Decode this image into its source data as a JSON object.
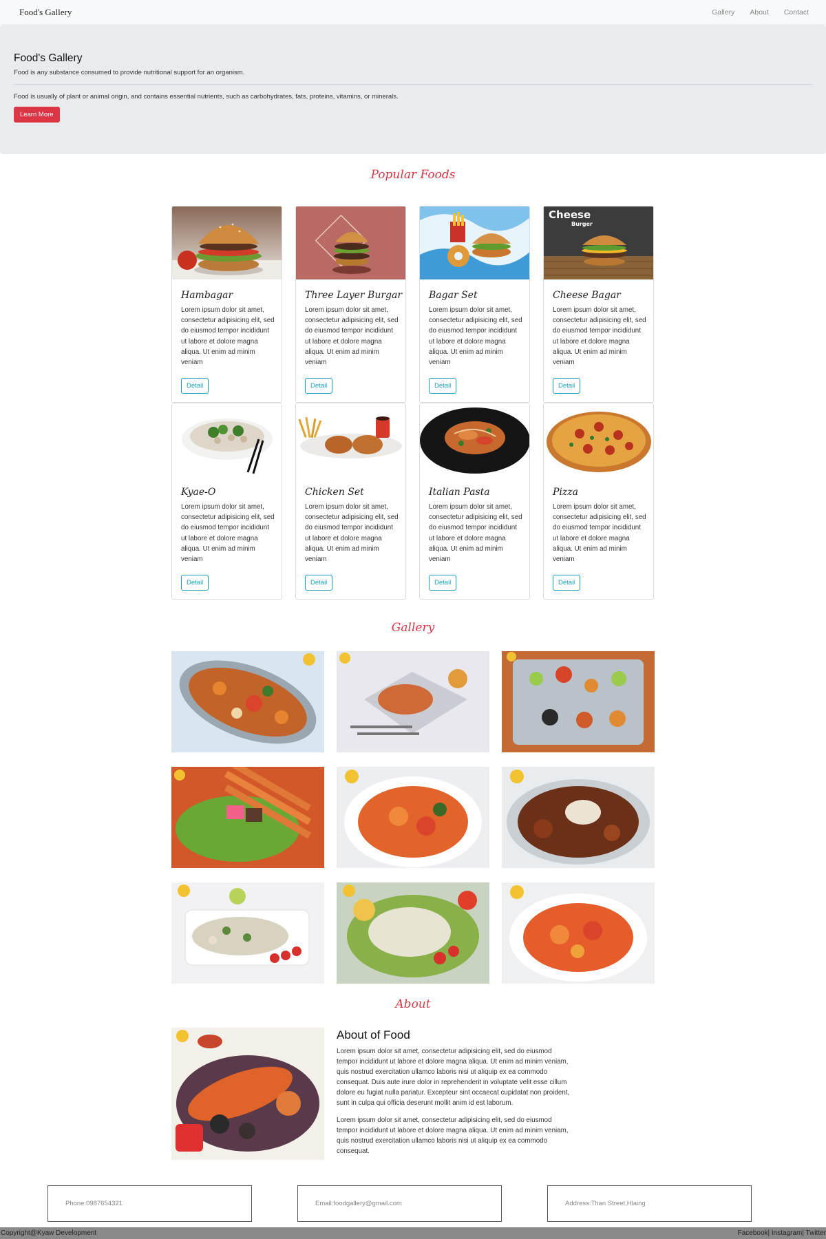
{
  "navbar": {
    "brand": "Food's Gallery",
    "links": [
      "Gallery",
      "About",
      "Contact"
    ]
  },
  "jumbotron": {
    "title": "Food's Gallery",
    "lead": "Food is any substance consumed to provide nutritional support for an organism.",
    "text": "Food is usually of plant or animal origin, and contains essential nutrients, such as carbohydrates, fats, proteins, vitamins, or minerals.",
    "button": "Learn More"
  },
  "popular": {
    "heading": "Popular Foods",
    "card_text": "Lorem ipsum dolor sit amet, consectetur adipisicing elit, sed do eiusmod tempor incididunt ut labore et dolore magna aliqua. Ut enim ad minim veniam",
    "detail_label": "Detail",
    "cards": [
      {
        "title": "Hambagar"
      },
      {
        "title": "Three Layer Burgar"
      },
      {
        "title": "Bagar Set"
      },
      {
        "title": "Cheese Bagar",
        "image_text": "Cheese",
        "image_subtext": "Burger"
      },
      {
        "title": "Kyae-O"
      },
      {
        "title": "Chicken Set"
      },
      {
        "title": "Italian Pasta"
      },
      {
        "title": "Pizza"
      }
    ]
  },
  "gallery": {
    "heading": "Gallery"
  },
  "about": {
    "heading": "About",
    "title": "About of Food",
    "p1": "Lorem ipsum dolor sit amet, consectetur adipisicing elit, sed do eiusmod tempor incididunt ut labore et dolore magna aliqua. Ut enim ad minim veniam, quis nostrud exercitation ullamco laboris nisi ut aliquip ex ea commodo consequat. Duis aute irure dolor in reprehenderit in voluptate velit esse cillum dolore eu fugiat nulla pariatur. Excepteur sint occaecat cupidatat non proident, sunt in culpa qui officia deserunt mollit anim id est laborum.",
    "p2": "Lorem ipsum dolor sit amet, consectetur adipisicing elit, sed do eiusmod tempor incididunt ut labore et dolore magna aliqua. Ut enim ad minim veniam, quis nostrud exercitation ullamco laboris nisi ut aliquip ex ea commodo consequat."
  },
  "contact": {
    "phone": "Phone:0987654321",
    "email": "Email:foodgallery@gmail.com",
    "address": "Address:Than Street,Hlaing"
  },
  "footer": {
    "copyright": "Copyright@Kyaw Development",
    "social": "Facebook| Instagram| Twitter"
  },
  "colors": {
    "accent_red": "#dc3545",
    "info_teal": "#17a2b8",
    "jumbotron_bg": "#e9ecef"
  }
}
